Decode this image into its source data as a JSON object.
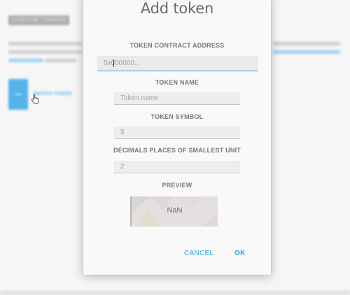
{
  "background": {
    "badge": "CUSTOM TOKENS",
    "watch_button_label": "WATCH TOKEN"
  },
  "dialog": {
    "title": "Add token",
    "contract_address": {
      "label": "TOKEN CONTRACT ADDRESS",
      "placeholder": "0x000000..",
      "value": ""
    },
    "token_name": {
      "label": "TOKEN NAME",
      "placeholder": "Token name",
      "value": ""
    },
    "token_symbol": {
      "label": "TOKEN SYMBOL",
      "placeholder": "$",
      "value": ""
    },
    "decimals": {
      "label": "DECIMALS PLACES OF SMALLEST UNIT",
      "placeholder": "2",
      "value": ""
    },
    "preview": {
      "label": "PREVIEW",
      "value": "NaN"
    },
    "actions": {
      "cancel": "CANCEL",
      "ok": "OK"
    }
  },
  "colors": {
    "accent": "#2ea3e6",
    "label": "#777777",
    "title": "#6a6a6a"
  }
}
